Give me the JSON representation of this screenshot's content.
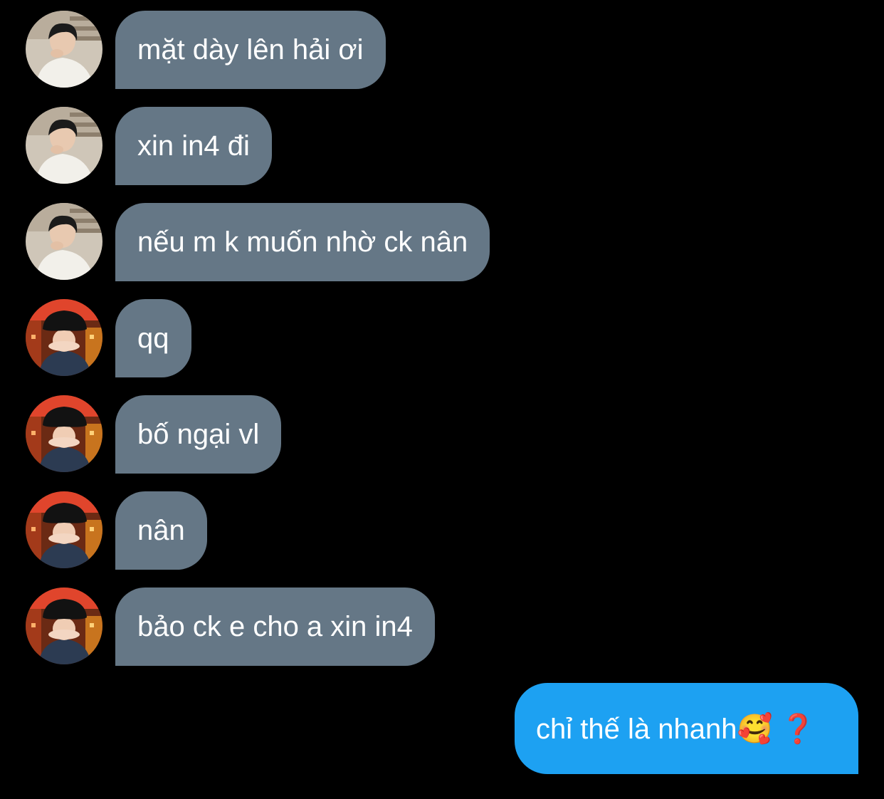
{
  "conversation": {
    "messages": [
      {
        "sender": "other",
        "avatar": "avatar-a",
        "text": "mặt dày lên hải ơi"
      },
      {
        "sender": "other",
        "avatar": "avatar-a",
        "text": "xin in4 đi"
      },
      {
        "sender": "other",
        "avatar": "avatar-a",
        "text": "nếu m k muốn nhờ ck nân"
      },
      {
        "sender": "other",
        "avatar": "avatar-b",
        "text": "qq"
      },
      {
        "sender": "other",
        "avatar": "avatar-b",
        "text": "bố ngại vl"
      },
      {
        "sender": "other",
        "avatar": "avatar-b",
        "text": "nân"
      },
      {
        "sender": "other",
        "avatar": "avatar-b",
        "text": "bảo ck e cho a xin in4"
      },
      {
        "sender": "me",
        "text": "chỉ thế là nhanh🥰 ❓"
      }
    ]
  },
  "colors": {
    "background": "#000000",
    "incoming_bubble": "#657786",
    "outgoing_bubble": "#1da1f2",
    "text": "#ffffff"
  }
}
